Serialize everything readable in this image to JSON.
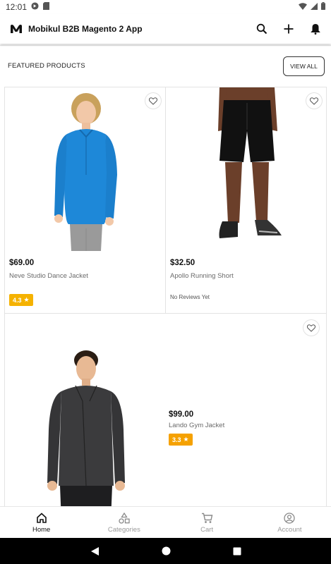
{
  "status_bar": {
    "time": "12:01",
    "icons": [
      "app-notification-icon",
      "sd-card-icon",
      "wifi-icon",
      "cell-signal-icon",
      "battery-icon"
    ]
  },
  "app_bar": {
    "title": "Mobikul B2B Magento 2 App",
    "actions": [
      "search-icon",
      "add-icon",
      "bell-icon"
    ]
  },
  "section": {
    "title": "FEATURED PRODUCTS",
    "view_all_label": "VIEW ALL"
  },
  "products": [
    {
      "price": "$69.00",
      "name": "Neve Studio Dance Jacket",
      "rating": "4.3",
      "rating_color": "#f5b200",
      "image": "blue-quarter-zip-jacket-model"
    },
    {
      "price": "$32.50",
      "name": "Apollo Running Short",
      "reviews_text": "No Reviews Yet",
      "image": "black-running-shorts-model"
    },
    {
      "price": "$99.00",
      "name": "Lando Gym Jacket",
      "rating": "3.3",
      "rating_color": "#f5a100",
      "image": "grey-fleece-jacket-model"
    }
  ],
  "bottom_nav": [
    {
      "label": "Home",
      "icon": "home-icon",
      "active": true
    },
    {
      "label": "Categories",
      "icon": "categories-icon",
      "active": false
    },
    {
      "label": "Cart",
      "icon": "cart-icon",
      "active": false
    },
    {
      "label": "Account",
      "icon": "account-icon",
      "active": false
    }
  ],
  "system_nav": [
    "back-icon",
    "home-circle-icon",
    "recents-icon"
  ],
  "colors": {
    "accent_dark": "#111111",
    "rating_yellow": "#f5b200",
    "rating_orange": "#f5a100",
    "jacket_blue": "#1e88d8"
  }
}
